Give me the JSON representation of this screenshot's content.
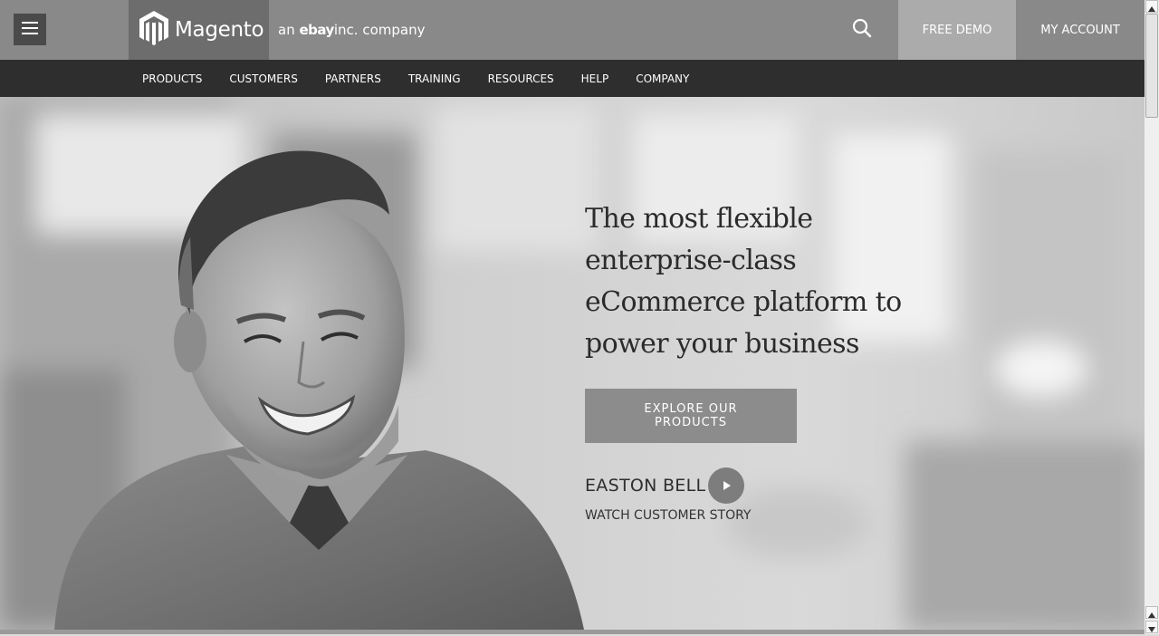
{
  "header": {
    "logo_text": "Magento",
    "tagline_prefix": "an",
    "tagline_brand": "ebay",
    "tagline_inc": "inc.",
    "tagline_suffix": "company",
    "free_demo": "FREE DEMO",
    "my_account": "MY ACCOUNT",
    "icons": [
      "menu-icon",
      "magento-logo-icon",
      "search-icon"
    ]
  },
  "nav": {
    "items": [
      "PRODUCTS",
      "CUSTOMERS",
      "PARTNERS",
      "TRAINING",
      "RESOURCES",
      "HELP",
      "COMPANY"
    ]
  },
  "hero": {
    "headline": "The most flexible enterprise-class eCommerce platform to power your business",
    "cta_label": "EXPLORE OUR PRODUCTS",
    "story_name": "EASTON BELL",
    "story_link": "WATCH CUSTOMER STORY",
    "icons": [
      "play-icon"
    ]
  },
  "colors": {
    "header_bg": "#898989",
    "logo_bg": "#6d6d6d",
    "demo_bg": "#ababab",
    "nav_bg": "#2e2e2e",
    "cta_bg": "#8c8c8c"
  }
}
